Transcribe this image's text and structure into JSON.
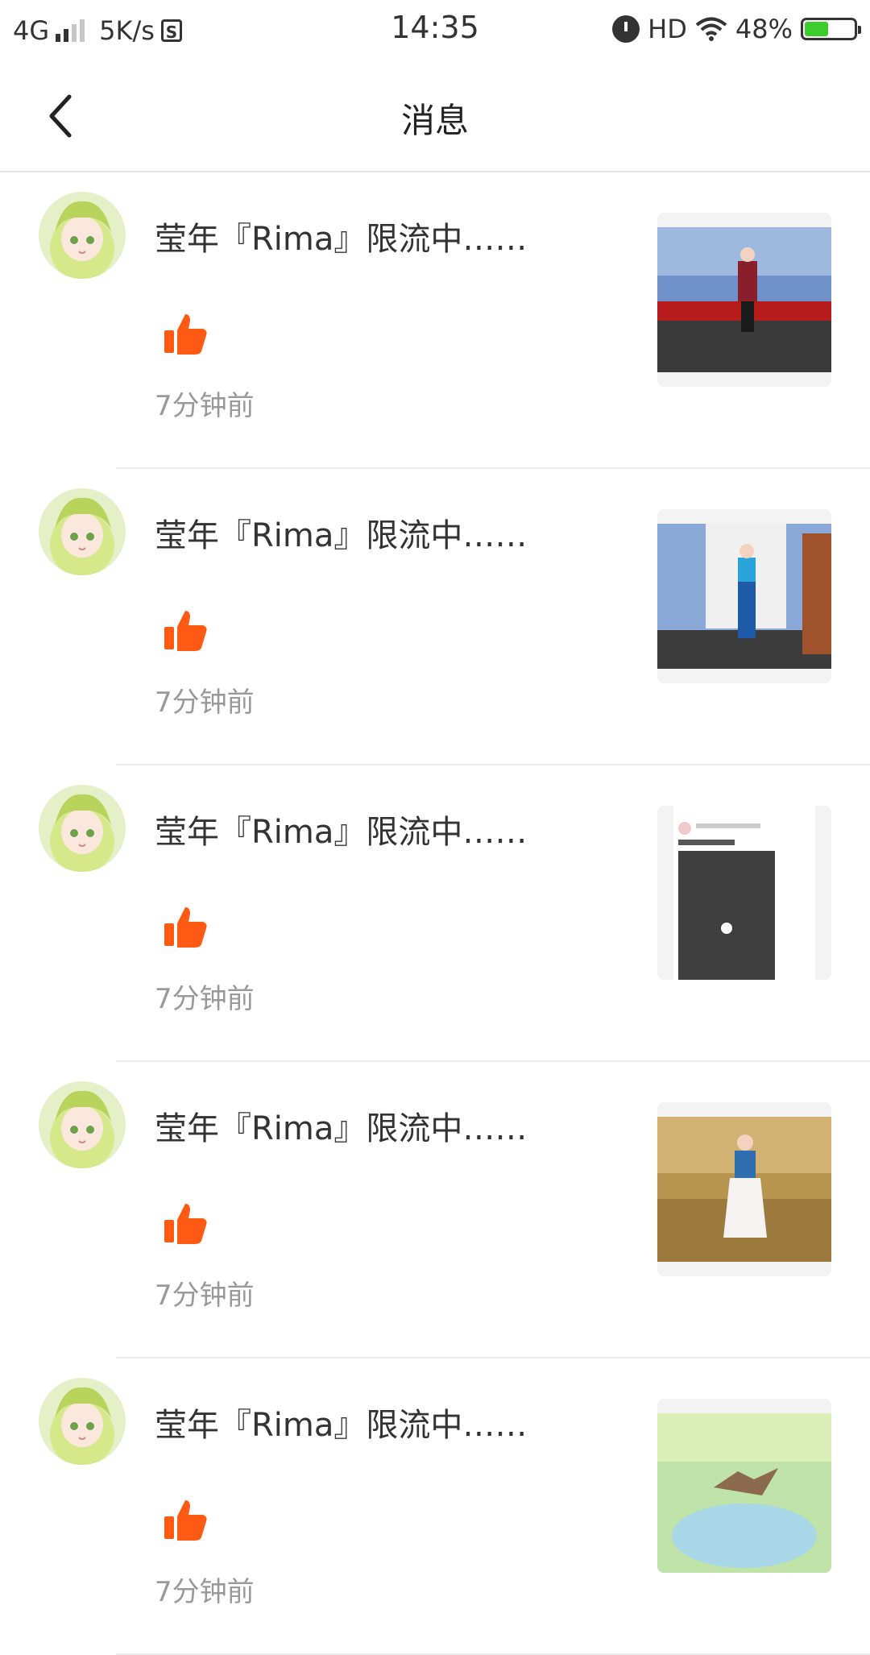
{
  "status_bar": {
    "network": "4G",
    "speed": "5K/s",
    "s_badge": "S",
    "time": "14:35",
    "hd": "HD",
    "battery": "48%",
    "battery_level": 0.48
  },
  "header": {
    "title": "消息",
    "back_icon": "chevron-left-icon"
  },
  "colors": {
    "like": "#FF5A14",
    "time_text": "#999999",
    "divider": "#ECECEC"
  },
  "messages": [
    {
      "name": "莹年『Rima』限流中……",
      "time": "7分钟前",
      "action_icon": "thumbs-up-icon",
      "thumb": "game-scene-bridge"
    },
    {
      "name": "莹年『Rima』限流中……",
      "time": "7分钟前",
      "action_icon": "thumbs-up-icon",
      "thumb": "game-scene-stairs"
    },
    {
      "name": "莹年『Rima』限流中……",
      "time": "7分钟前",
      "action_icon": "thumbs-up-icon",
      "thumb": "app-screenshot"
    },
    {
      "name": "莹年『Rima』限流中……",
      "time": "7分钟前",
      "action_icon": "thumbs-up-icon",
      "thumb": "game-scene-room"
    },
    {
      "name": "莹年『Rima』限流中……",
      "time": "7分钟前",
      "action_icon": "thumbs-up-icon",
      "thumb": "game-scene-field"
    }
  ]
}
